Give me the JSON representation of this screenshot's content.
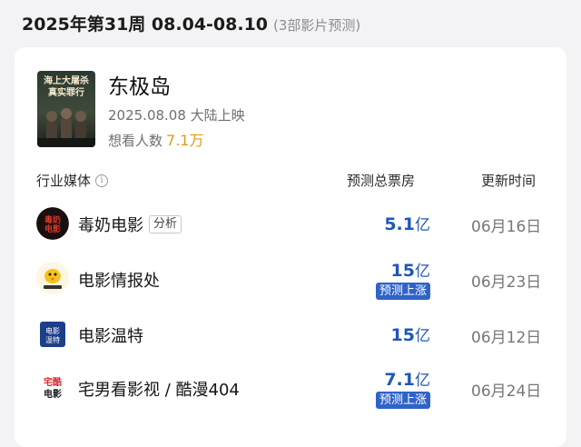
{
  "header": {
    "week_title": "2025年第31周 08.04-08.10",
    "note": "(3部影片预测)"
  },
  "movie": {
    "title": "东极岛",
    "release": "2025.08.08 大陆上映",
    "want_label": "想看人数",
    "want_value": "7.1万",
    "poster_text_line1": "海上大屠杀",
    "poster_text_line2": "真实罪行"
  },
  "table": {
    "col_media": "行业媒体",
    "col_forecast": "预测总票房",
    "col_update": "更新时间",
    "info_icon": "i"
  },
  "rows": [
    {
      "name": "毒奶电影",
      "tag": "分析",
      "value": "5.1",
      "unit": "亿",
      "badge": "",
      "date": "06月16日",
      "avatar_icon": "dunai-logo-icon"
    },
    {
      "name": "电影情报处",
      "tag": "",
      "value": "15",
      "unit": "亿",
      "badge": "预测上涨",
      "date": "06月23日",
      "avatar_icon": "bird-logo-icon"
    },
    {
      "name": "电影温特",
      "tag": "",
      "value": "15",
      "unit": "亿",
      "badge": "",
      "date": "06月12日",
      "avatar_icon": "wente-logo-icon"
    },
    {
      "name": "宅男看影视 / 酷漫404",
      "tag": "",
      "value": "7.1",
      "unit": "亿",
      "badge": "预测上涨",
      "date": "06月24日",
      "avatar_icon": "zhainan-logo-icon"
    }
  ],
  "colors": {
    "accent_blue": "#1f57b8",
    "badge_blue": "#2f63c8",
    "want_orange": "#e59a12"
  }
}
